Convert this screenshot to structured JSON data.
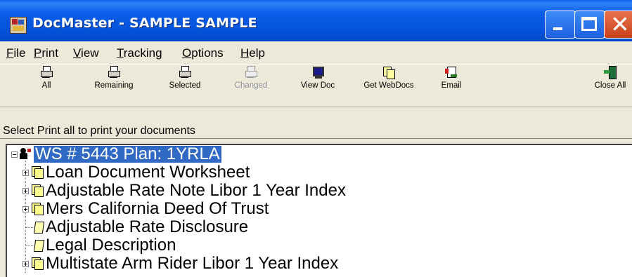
{
  "window": {
    "title": "DocMaster - SAMPLE SAMPLE",
    "controls": [
      "minimize",
      "maximize",
      "close"
    ]
  },
  "menu": [
    {
      "label": "File",
      "accel": "F",
      "rest": "ile"
    },
    {
      "label": "Print",
      "accel": "P",
      "rest": "rint"
    },
    {
      "label": "View",
      "accel": "V",
      "rest": "iew"
    },
    {
      "label": "Tracking",
      "accel": "T",
      "rest": "racking"
    },
    {
      "label": "Options",
      "accel": "O",
      "rest": "ptions"
    },
    {
      "label": "Help",
      "accel": "H",
      "rest": "elp"
    }
  ],
  "toolbar": {
    "all": "All",
    "remaining": "Remaining",
    "selected": "Selected",
    "changed": "Changed",
    "view_doc": "View Doc",
    "get_web_docs": "Get WebDocs",
    "email": "Email",
    "close_all": "Close All"
  },
  "hint": "Select Print all to print your documents",
  "tree": {
    "root": "WS # 5443    Plan: 1YRLA",
    "items": [
      {
        "label": "Loan Document Worksheet",
        "expandable": true
      },
      {
        "label": "Adjustable Rate Note Libor 1 Year Index",
        "expandable": true
      },
      {
        "label": "Mers California Deed Of Trust",
        "expandable": true
      },
      {
        "label": "Adjustable Rate Disclosure",
        "expandable": false
      },
      {
        "label": "Legal Description",
        "expandable": false
      },
      {
        "label": "Multistate Arm Rider Libor 1 Year Index",
        "expandable": true
      }
    ]
  },
  "colors": {
    "titlebar": "#0454DC",
    "selection": "#316AC5",
    "face": "#ECE9D8",
    "close_button": "#D9532A"
  }
}
